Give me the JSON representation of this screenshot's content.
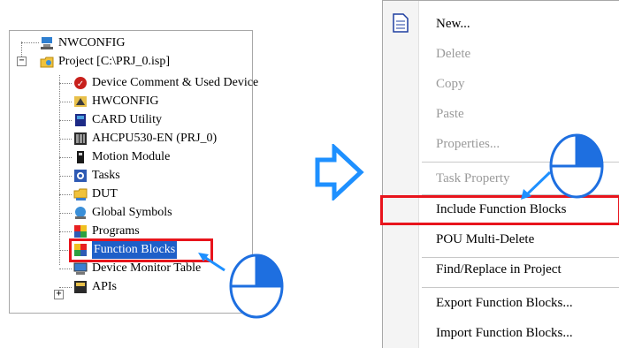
{
  "tree": {
    "items": [
      {
        "label": "NWCONFIG"
      },
      {
        "label": "Project [C:\\PRJ_0.isp]"
      },
      {
        "label": "Device Comment & Used Device"
      },
      {
        "label": "HWCONFIG"
      },
      {
        "label": "CARD Utility"
      },
      {
        "label": "AHCPU530-EN  (PRJ_0)"
      },
      {
        "label": "Motion Module"
      },
      {
        "label": "Tasks"
      },
      {
        "label": "DUT"
      },
      {
        "label": "Global Symbols"
      },
      {
        "label": "Programs"
      },
      {
        "label": "Function Blocks"
      },
      {
        "label": "Device Monitor Table"
      },
      {
        "label": "APIs"
      }
    ],
    "expander_minus": "−",
    "expander_plus": "+"
  },
  "menu": {
    "items": [
      {
        "label": "New...",
        "disabled": false
      },
      {
        "label": "Delete",
        "disabled": true
      },
      {
        "label": "Copy",
        "disabled": true
      },
      {
        "label": "Paste",
        "disabled": true
      },
      {
        "label": "Properties...",
        "disabled": true
      },
      {
        "label": "Task Property",
        "disabled": true
      },
      {
        "label": "Include Function Blocks",
        "disabled": false
      },
      {
        "label": "POU Multi-Delete",
        "disabled": false
      },
      {
        "label": "Find/Replace in Project",
        "disabled": false
      },
      {
        "label": "Export Function Blocks...",
        "disabled": false
      },
      {
        "label": "Import Function Blocks...",
        "disabled": false
      }
    ]
  },
  "colors": {
    "highlight": "#e8141c",
    "selection": "#1e5fc8",
    "arrow": "#1e90ff"
  }
}
